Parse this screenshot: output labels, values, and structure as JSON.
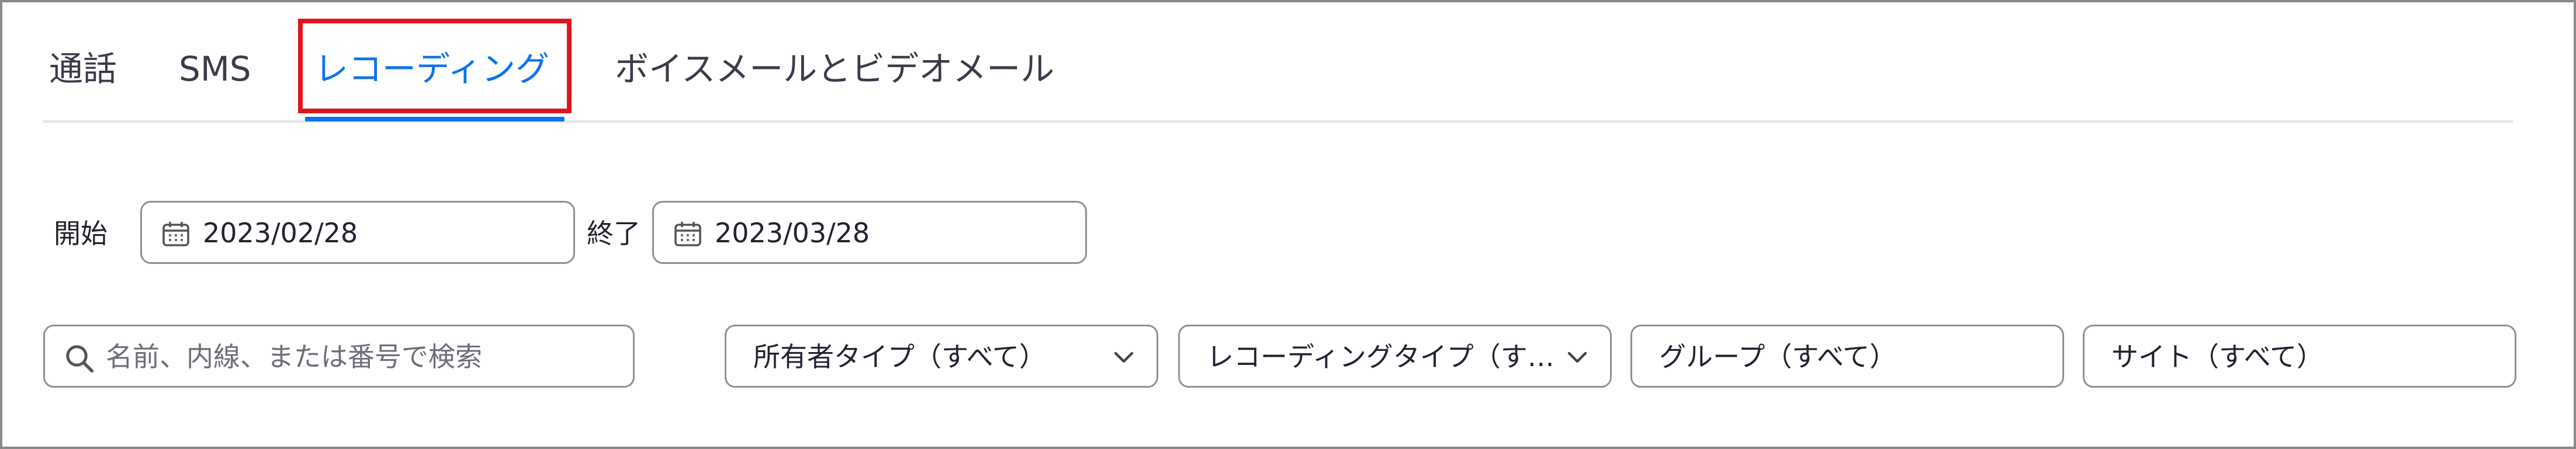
{
  "tabs": [
    {
      "label": "通話",
      "active": false
    },
    {
      "label": "SMS",
      "active": false
    },
    {
      "label": "レコーディング",
      "active": true
    },
    {
      "label": "ボイスメールとビデオメール",
      "active": false
    }
  ],
  "date_filter": {
    "start_label": "開始",
    "start_value": "2023/02/28",
    "end_label": "終了",
    "end_value": "2023/03/28",
    "icon": "calendar-icon"
  },
  "filters": {
    "search_placeholder": "名前、内線、または番号で検索",
    "owner_type": "所有者タイプ（すべて）",
    "recording_type": "レコーディングタイプ（す…",
    "group": "グループ（すべて）",
    "site": "サイト（すべて）"
  },
  "colors": {
    "accent": "#0e72ed",
    "highlight": "#e0141e",
    "border": "#8f8f9a"
  }
}
